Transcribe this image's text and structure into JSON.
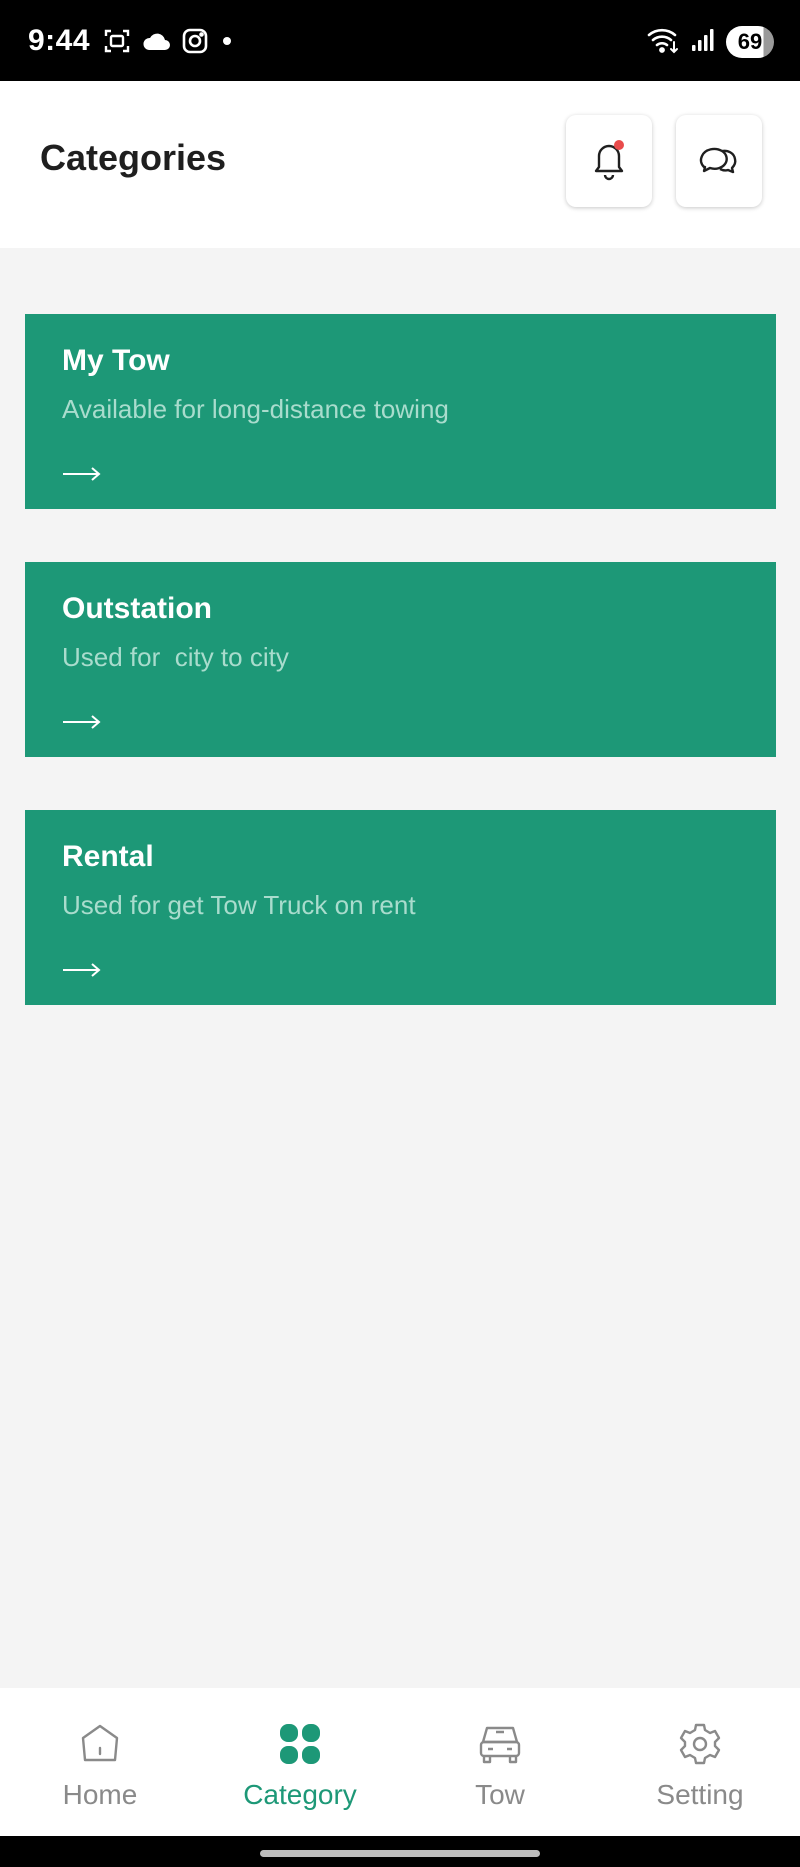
{
  "status_bar": {
    "time": "9:44",
    "battery": "69",
    "icons": [
      "screenshot-icon",
      "cloud-icon",
      "instagram-icon",
      "dot-icon",
      "wifi-icon",
      "signal-icon",
      "battery-icon"
    ]
  },
  "header": {
    "title": "Categories",
    "notification_icon": "bell-icon",
    "chat_icon": "chat-bubbles-icon",
    "notification_badge_color": "#e94b4b"
  },
  "categories": [
    {
      "title": "My Tow",
      "subtitle": "Available for long-distance towing",
      "icon": "arrow-right-icon"
    },
    {
      "title": "Outstation",
      "subtitle": "Used for  city to city",
      "icon": "arrow-right-icon"
    },
    {
      "title": "Rental",
      "subtitle": "Used for get Tow Truck on rent",
      "icon": "arrow-right-icon"
    }
  ],
  "bottom_nav": {
    "items": [
      {
        "label": "Home",
        "icon": "home-icon",
        "active": false
      },
      {
        "label": "Category",
        "icon": "grid-icon",
        "active": true
      },
      {
        "label": "Tow",
        "icon": "car-icon",
        "active": false
      },
      {
        "label": "Setting",
        "icon": "gear-icon",
        "active": false
      }
    ]
  },
  "colors": {
    "accent": "#1d9877",
    "card_subtitle": "#a9dccd",
    "inactive": "#8a8a8a",
    "background": "#f4f4f4"
  }
}
